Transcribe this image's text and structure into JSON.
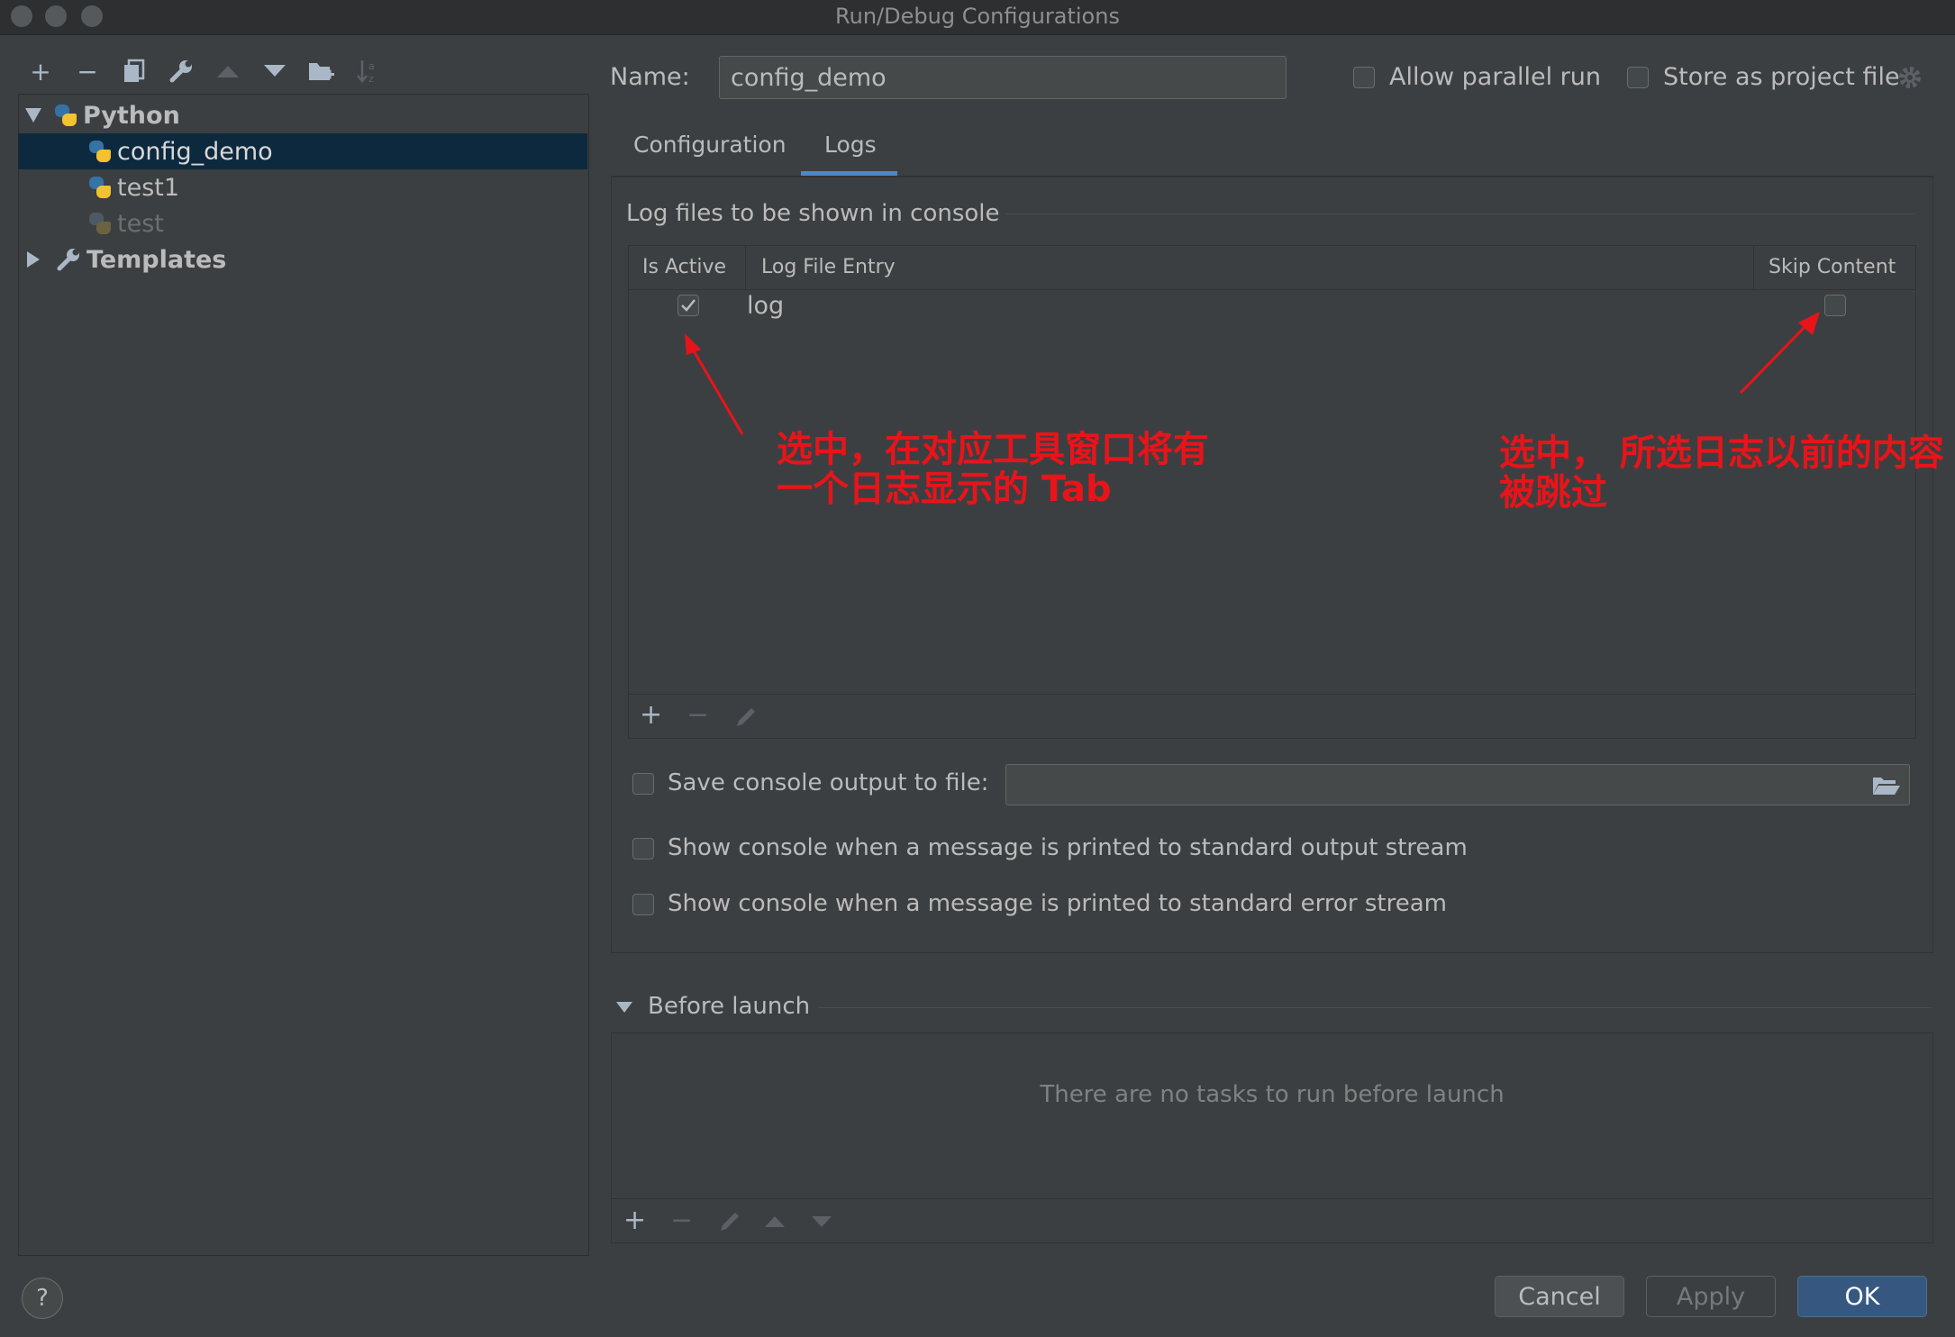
{
  "window": {
    "title": "Run/Debug Configurations"
  },
  "toolbar": {
    "add": "+",
    "remove": "−"
  },
  "tree": {
    "python_label": "Python",
    "items": [
      "config_demo",
      "test1",
      "test"
    ],
    "templates_label": "Templates"
  },
  "form": {
    "name_label": "Name:",
    "name_value": "config_demo",
    "allow_parallel_label": "Allow parallel run",
    "store_project_label": "Store as project file"
  },
  "tabs": [
    "Configuration",
    "Logs"
  ],
  "logs": {
    "section_title": "Log files to be shown in console",
    "columns": [
      "Is Active",
      "Log File Entry",
      "Skip Content"
    ],
    "rows": [
      {
        "active": true,
        "entry": "log",
        "skip": false
      }
    ]
  },
  "annotations": {
    "left_line1": "选中，在对应工具窗口将有",
    "left_line2": "一个日志显示的 Tab",
    "right_line1": "选中， 所选日志以前的内容",
    "right_line2": "被跳过"
  },
  "options": {
    "save_console_label": "Save console output to file:",
    "show_stdout_label": "Show console when a message is printed to standard output stream",
    "show_stderr_label": "Show console when a message is printed to standard error stream"
  },
  "before_launch": {
    "title": "Before launch",
    "empty_text": "There are no tasks to run before launch"
  },
  "buttons": {
    "help": "?",
    "cancel": "Cancel",
    "apply": "Apply",
    "ok": "OK"
  },
  "colors": {
    "accent": "#4a88c7",
    "selection": "#0d293e",
    "annotation": "#e8141a"
  }
}
